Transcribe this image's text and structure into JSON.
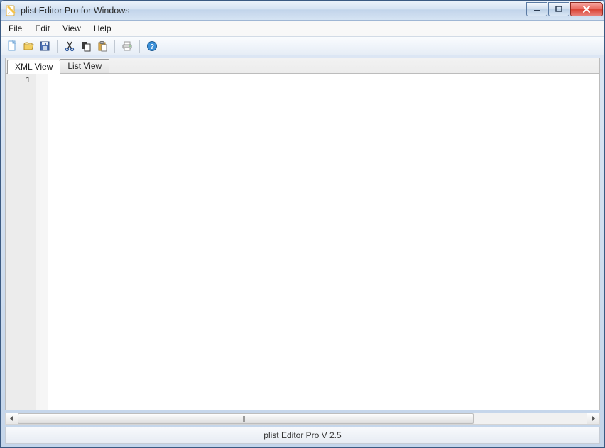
{
  "window": {
    "title": "plist Editor Pro for Windows"
  },
  "menu": {
    "items": [
      "File",
      "Edit",
      "View",
      "Help"
    ]
  },
  "toolbar": {
    "items": [
      {
        "name": "new-file-icon"
      },
      {
        "name": "open-file-icon"
      },
      {
        "name": "save-icon"
      },
      {
        "sep": true
      },
      {
        "name": "cut-icon"
      },
      {
        "name": "copy-icon"
      },
      {
        "name": "paste-icon"
      },
      {
        "sep": true
      },
      {
        "name": "print-icon"
      },
      {
        "sep": true
      },
      {
        "name": "help-icon"
      }
    ]
  },
  "tabs": {
    "items": [
      {
        "label": "XML View",
        "active": true
      },
      {
        "label": "List View",
        "active": false
      }
    ]
  },
  "editor": {
    "lines": [
      "1"
    ]
  },
  "status": {
    "text": "plist Editor Pro V 2.5"
  }
}
